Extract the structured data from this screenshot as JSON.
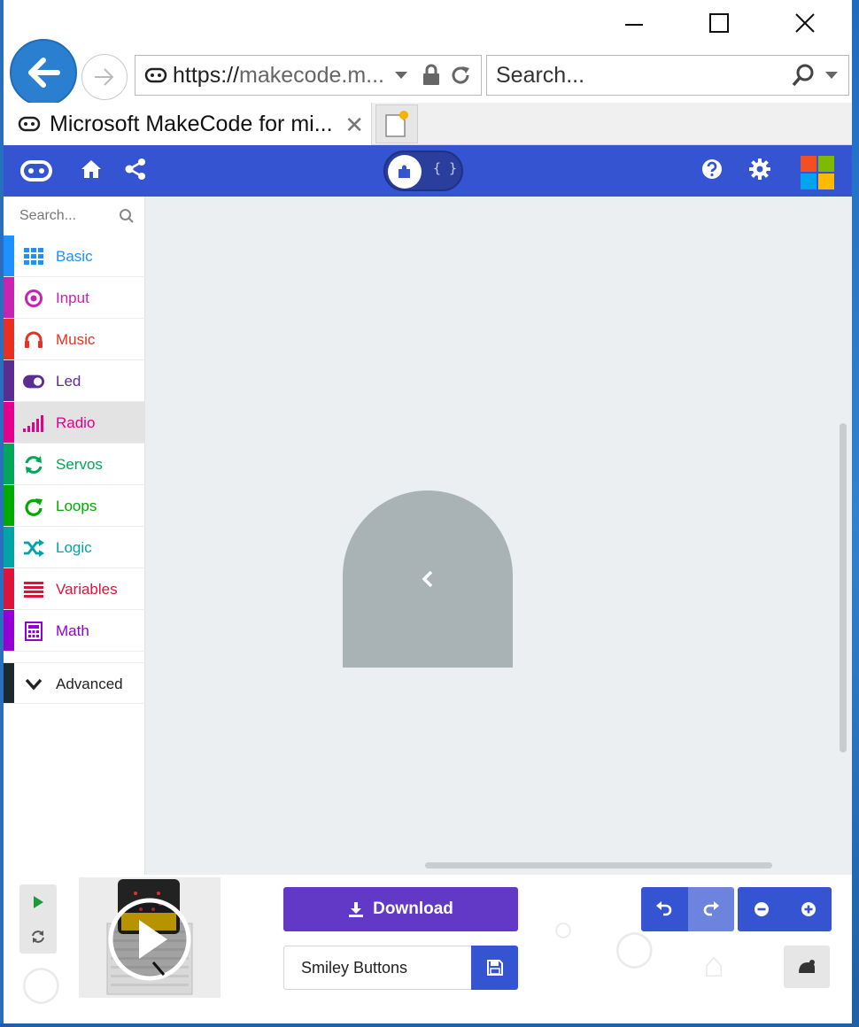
{
  "browser": {
    "address": {
      "scheme": "https://",
      "host": "makecode.m..."
    },
    "search_placeholder": "Search...",
    "tab_title": "Microsoft MakeCode for mi..."
  },
  "toolbox": {
    "search_placeholder": "Search...",
    "categories": [
      {
        "label": "Basic",
        "color": "#1e90ff",
        "icon": "grid-icon"
      },
      {
        "label": "Input",
        "color": "#c724b1",
        "icon": "target-icon"
      },
      {
        "label": "Music",
        "color": "#e63022",
        "icon": "headphones-icon"
      },
      {
        "label": "Led",
        "color": "#5c2d91",
        "icon": "toggle-icon"
      },
      {
        "label": "Radio",
        "color": "#e3008c",
        "icon": "signal-bars-icon"
      },
      {
        "label": "Servos",
        "color": "#00a65a",
        "icon": "refresh-icon"
      },
      {
        "label": "Loops",
        "color": "#00aa00",
        "icon": "loop-icon"
      },
      {
        "label": "Logic",
        "color": "#00a4a6",
        "icon": "shuffle-icon"
      },
      {
        "label": "Variables",
        "color": "#dc143c",
        "icon": "lines-icon"
      },
      {
        "label": "Math",
        "color": "#9400d3",
        "icon": "calculator-icon"
      },
      {
        "label": "Advanced",
        "color": "#3c3c3c",
        "icon": "chevron-down-icon"
      }
    ]
  },
  "editor": {
    "download_label": "Download",
    "project_name": "Smiley Buttons"
  },
  "colors": {
    "header": "#3454d1",
    "download": "#6239c6",
    "workspace": "#eceff1",
    "flyout": "#a9b2b5"
  }
}
